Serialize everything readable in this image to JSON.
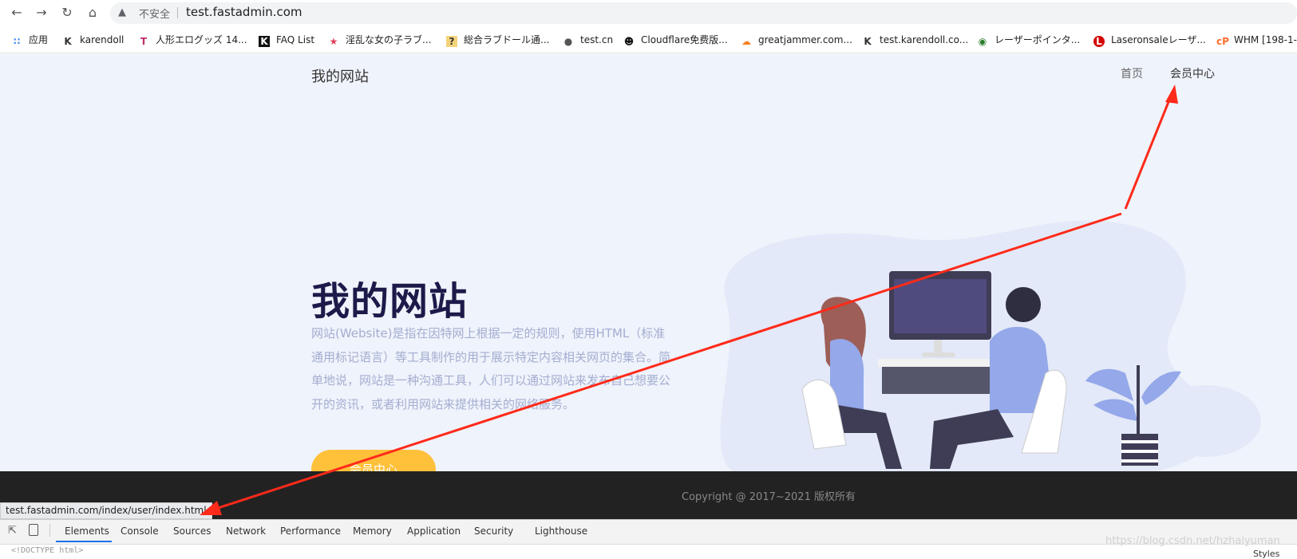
{
  "browser": {
    "insecure_label": "不安全",
    "url": "test.fastadmin.com",
    "bookmarks": [
      {
        "label": "应用",
        "icon": "apps-grid-icon"
      },
      {
        "label": "karendoll",
        "icon": "k-logo-icon"
      },
      {
        "label": "人形エログッズ 14...",
        "icon": "t-logo-icon"
      },
      {
        "label": "FAQ List",
        "icon": "k-black-logo-icon"
      },
      {
        "label": "淫乱な女の子ラブ...",
        "icon": "pink-figure-icon"
      },
      {
        "label": "総合ラブドール通...",
        "icon": "question-logo-icon"
      },
      {
        "label": "test.cn",
        "icon": "globe-icon"
      },
      {
        "label": "Cloudflare免费版...",
        "icon": "face-logo-icon"
      },
      {
        "label": "greatjammer.com...",
        "icon": "cloud-icon"
      },
      {
        "label": "test.karendoll.co...",
        "icon": "k-logo-icon"
      },
      {
        "label": "レーザーポインタ...",
        "icon": "eye-logo-icon"
      },
      {
        "label": "Laseronsaleレーザ...",
        "icon": "red-l-icon"
      },
      {
        "label": "WHM [198-1-",
        "icon": "cpanel-icon"
      }
    ]
  },
  "site": {
    "brand": "我的网站",
    "nav": {
      "home": "首页",
      "member": "会员中心"
    },
    "hero": {
      "title": "我的网站",
      "description": "网站(Website)是指在因特网上根据一定的规则，使用HTML（标准通用标记语言）等工具制作的用于展示特定内容相关网页的集合。简单地说，网站是一种沟通工具，人们可以通过网站来发布自己想要公开的资讯，或者利用网站来提供相关的网络服务。",
      "button": "会员中心"
    },
    "footer": {
      "copyright": "Copyright @ 2017~2021 版权所有"
    }
  },
  "status_url": "test.fastadmin.com/index/user/index.html",
  "devtools": {
    "tabs": [
      "Elements",
      "Console",
      "Sources",
      "Network",
      "Performance",
      "Memory",
      "Application",
      "Security",
      "Lighthouse"
    ],
    "active_tab": "Elements",
    "doctype": "<!DOCTYPE html>",
    "styles_label": "Styles",
    "watermark": "https://blog.csdn.net/hzhaiyuman"
  },
  "colors": {
    "page_bg": "#eff3fb",
    "title": "#1d1a4a",
    "desc": "#a4aed1",
    "button": "#ffc13a",
    "footer": "#222222",
    "annotation_arrow": "#ff2a1a"
  }
}
